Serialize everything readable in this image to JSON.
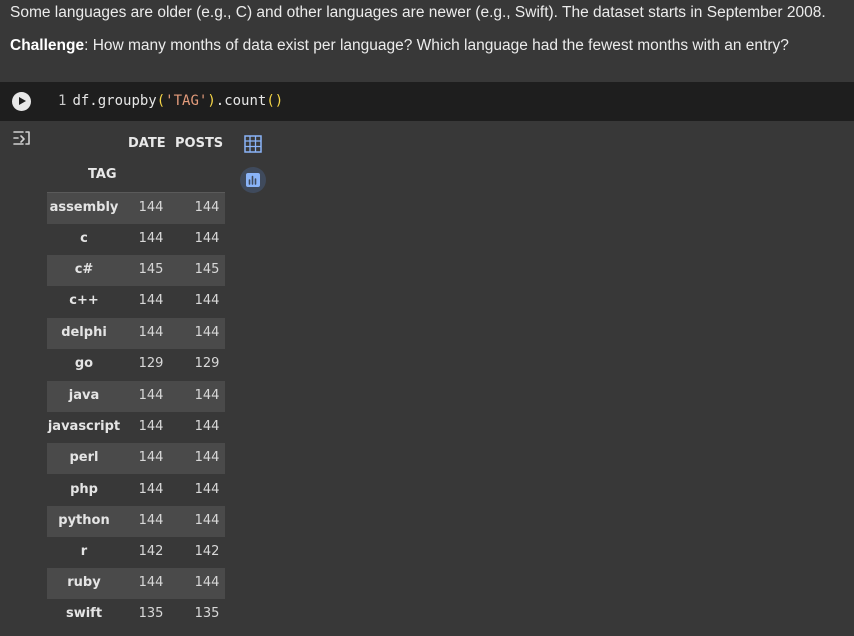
{
  "markdown": {
    "line1": "Some languages are older (e.g., C) and other languages are newer (e.g., Swift). The dataset starts in September 2008.",
    "challenge_label": "Challenge",
    "challenge_text": ": How many months of data exist per language? Which language had the fewest months with an entry?"
  },
  "code_cell": {
    "line_number": "1",
    "code_prefix": "df.groupby",
    "paren_open": "(",
    "string_arg": "'TAG'",
    "paren_close": ")",
    "method": ".count",
    "call_parens": "()"
  },
  "dataframe": {
    "columns": [
      "DATE",
      "POSTS"
    ],
    "index_name": "TAG",
    "rows": [
      {
        "tag": "assembly",
        "date": "144",
        "posts": "144"
      },
      {
        "tag": "c",
        "date": "144",
        "posts": "144"
      },
      {
        "tag": "c#",
        "date": "145",
        "posts": "145"
      },
      {
        "tag": "c++",
        "date": "144",
        "posts": "144"
      },
      {
        "tag": "delphi",
        "date": "144",
        "posts": "144"
      },
      {
        "tag": "go",
        "date": "129",
        "posts": "129"
      },
      {
        "tag": "java",
        "date": "144",
        "posts": "144"
      },
      {
        "tag": "javascript",
        "date": "144",
        "posts": "144"
      },
      {
        "tag": "perl",
        "date": "144",
        "posts": "144"
      },
      {
        "tag": "php",
        "date": "144",
        "posts": "144"
      },
      {
        "tag": "python",
        "date": "144",
        "posts": "144"
      },
      {
        "tag": "r",
        "date": "142",
        "posts": "142"
      },
      {
        "tag": "ruby",
        "date": "144",
        "posts": "144"
      },
      {
        "tag": "swift",
        "date": "135",
        "posts": "135"
      }
    ]
  },
  "icons": {
    "run": "play-icon",
    "output_toggle": "output-toggle-icon",
    "table_view": "table-icon",
    "chart_suggest": "bar-chart-icon"
  },
  "colors": {
    "background": "#383838",
    "code_background": "#1e1e1e",
    "string": "#e39b7b",
    "paren": "#f5d547",
    "stripe": "#4a4a4a",
    "accent_icon": "#8ab4f8"
  }
}
